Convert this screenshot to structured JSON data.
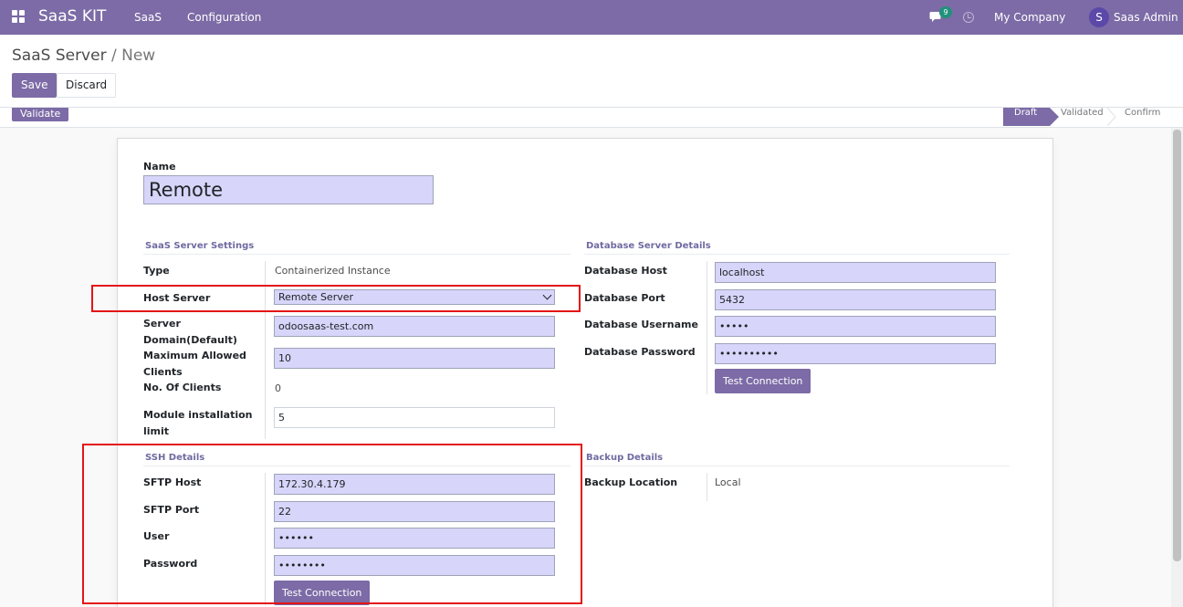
{
  "navbar": {
    "brand": "SaaS KIT",
    "menu": [
      "SaaS",
      "Configuration"
    ],
    "chat_count": "9",
    "company": "My Company",
    "avatar_initial": "S",
    "user": "Saas Admin"
  },
  "breadcrumb": {
    "parent": "SaaS Server",
    "separator": "/",
    "current": "New"
  },
  "actions": {
    "save": "Save",
    "discard": "Discard",
    "validate": "Validate"
  },
  "stages": [
    {
      "label": "Draft",
      "active": true
    },
    {
      "label": "Validated",
      "active": false
    },
    {
      "label": "Confirm",
      "active": false
    }
  ],
  "form": {
    "name_label": "Name",
    "name_value": "Remote",
    "server_settings": {
      "title": "SaaS Server Settings",
      "type_label": "Type",
      "type_value": "Containerized Instance",
      "host_server_label": "Host Server",
      "host_server_value": "Remote Server",
      "domain_label": "Server Domain(Default)",
      "domain_value": "odoosaas-test.com",
      "max_clients_label": "Maximum Allowed Clients",
      "max_clients_value": "10",
      "num_clients_label": "No. Of Clients",
      "num_clients_value": "0",
      "module_limit_label": "Module installation limit",
      "module_limit_value": "5"
    },
    "db_details": {
      "title": "Database Server Details",
      "host_label": "Database Host",
      "host_value": "localhost",
      "port_label": "Database Port",
      "port_value": "5432",
      "username_label": "Database Username",
      "username_value": "•••••",
      "password_label": "Database Password",
      "password_value": "••••••••••",
      "test_button": "Test Connection"
    },
    "ssh_details": {
      "title": "SSH Details",
      "host_label": "SFTP Host",
      "host_value": "172.30.4.179",
      "port_label": "SFTP Port",
      "port_value": "22",
      "user_label": "User",
      "user_value": "••••••",
      "password_label": "Password",
      "password_value": "••••••••",
      "test_button": "Test Connection"
    },
    "backup_details": {
      "title": "Backup Details",
      "location_label": "Backup Location",
      "location_value": "Local"
    }
  },
  "colors": {
    "primary": "#7c6ba6",
    "highlight": "#e41515",
    "field_bg": "#d7d5f9"
  }
}
